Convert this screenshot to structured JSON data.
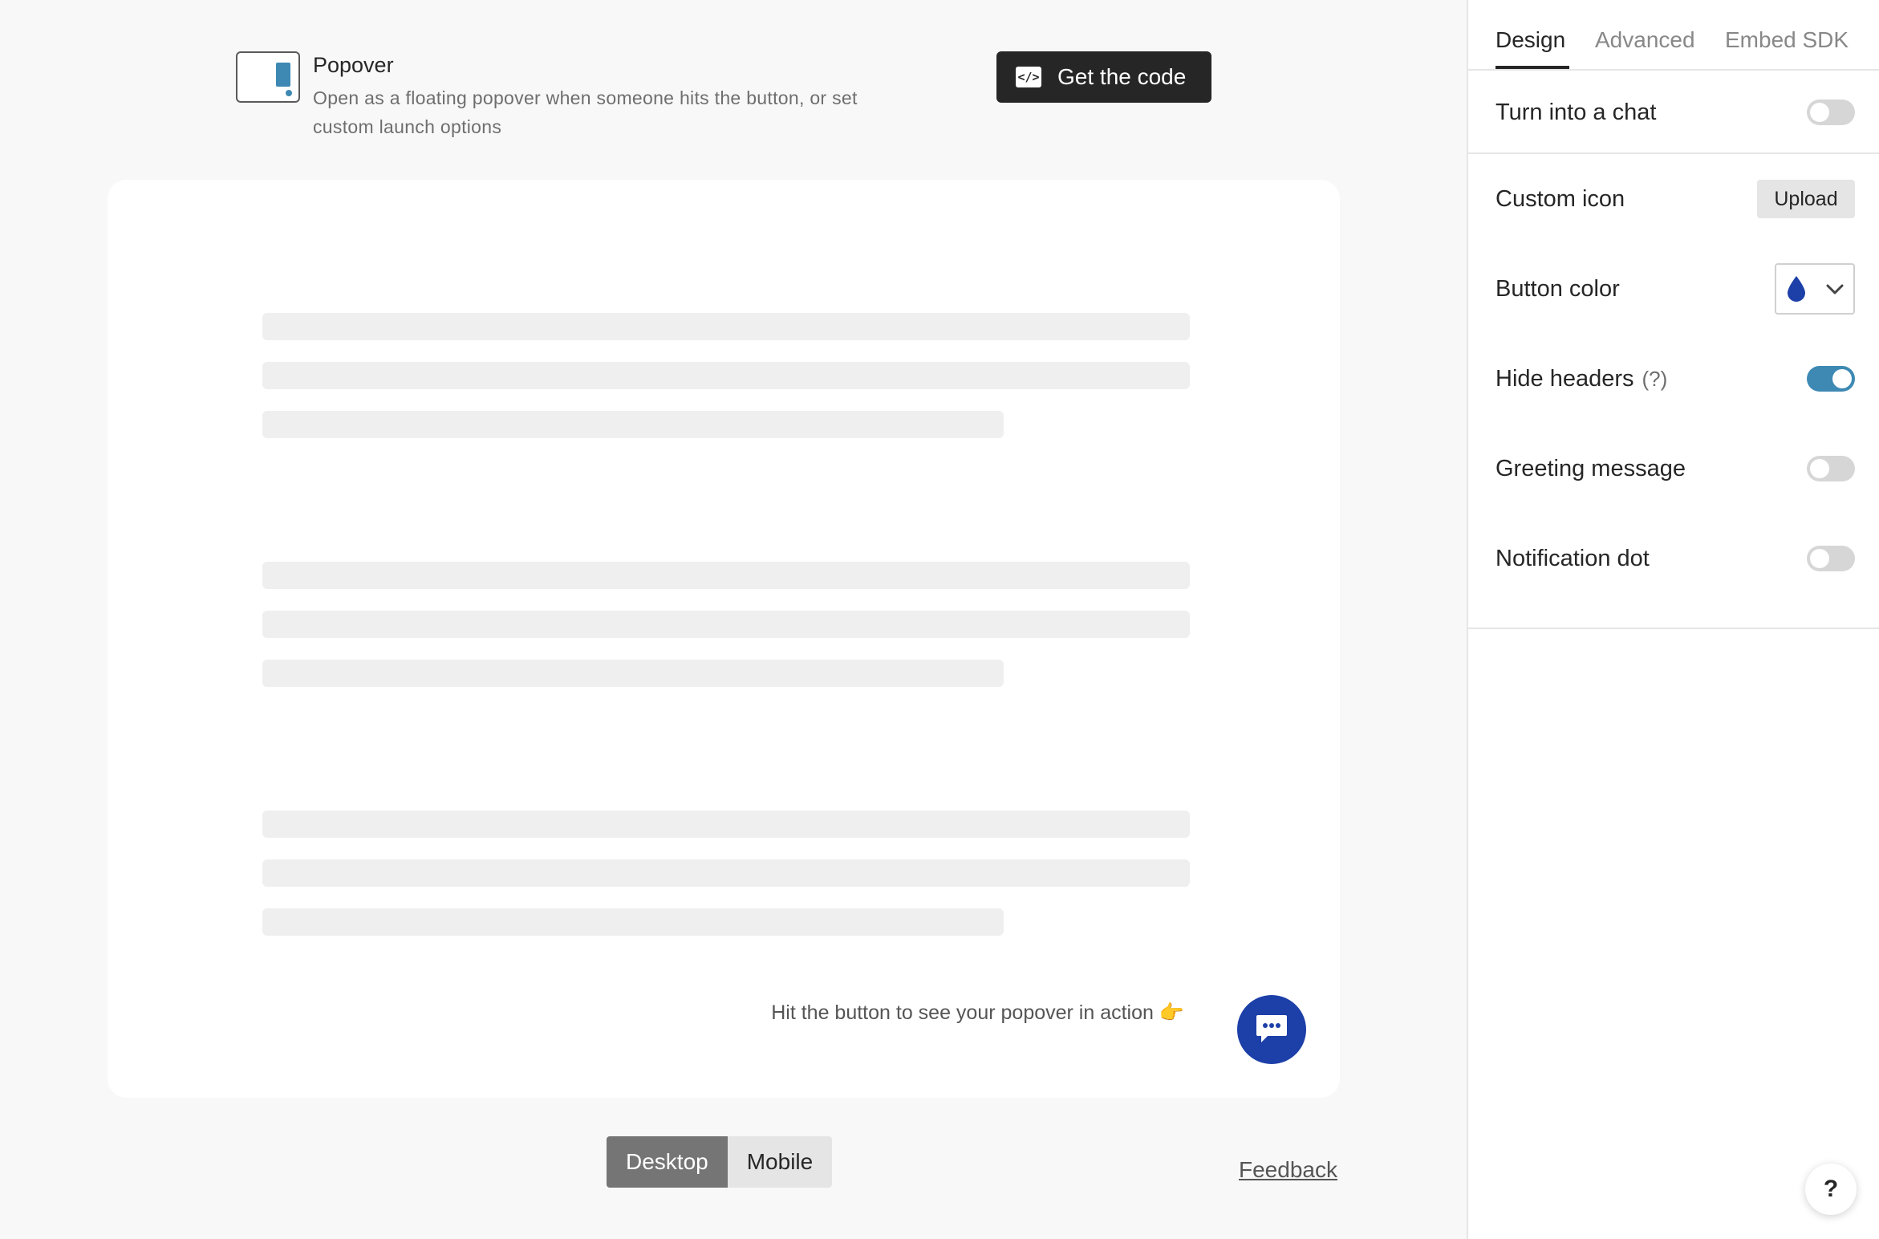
{
  "header": {
    "embed_type_title": "Popover",
    "embed_type_description": "Open as a floating popover when someone hits the button, or set custom launch options",
    "get_code_label": "Get the code",
    "code_icon_glyph": "</>"
  },
  "preview": {
    "hint_text": "Hit the button to see your popover in action 👉",
    "launcher_icon": "chat-bubble-icon",
    "launcher_color": "#1c3fa8"
  },
  "device_toggle": {
    "desktop_label": "Desktop",
    "mobile_label": "Mobile",
    "selected": "Desktop"
  },
  "feedback_label": "Feedback",
  "side_panel": {
    "tabs": [
      {
        "label": "Design",
        "active": true
      },
      {
        "label": "Advanced",
        "active": false
      },
      {
        "label": "Embed SDK",
        "active": false
      }
    ],
    "turn_into_chat": {
      "label": "Turn into a chat",
      "on": false
    },
    "custom_icon": {
      "label": "Custom icon",
      "button_label": "Upload"
    },
    "button_color": {
      "label": "Button color",
      "value": "#1c3fa8"
    },
    "hide_headers": {
      "label": "Hide headers",
      "hint": "(?)",
      "on": true
    },
    "greeting_message": {
      "label": "Greeting message",
      "on": false
    },
    "notification_dot": {
      "label": "Notification dot",
      "on": false
    },
    "help_label": "?"
  },
  "colors": {
    "accent_toggle": "#3d89b3",
    "dark_button": "#262627",
    "launcher": "#1c3fa8"
  }
}
